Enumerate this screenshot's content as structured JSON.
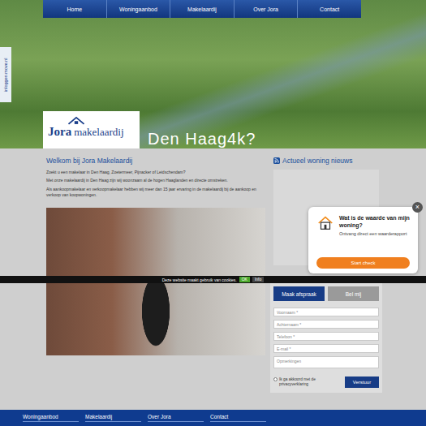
{
  "nav": [
    "Home",
    "Woningaanbod",
    "Makelaardij",
    "Over Jora",
    "Contact"
  ],
  "side_tab": "inloggen move.nl",
  "logo": {
    "name": "Jora",
    "suffix": "makelaardij"
  },
  "hero_caption": "Den Haag4k?",
  "welcome": {
    "title": "Welkom bij Jora Makelaardij",
    "paragraphs": [
      "Zoekt u een makelaar in Den Haag, Zoetermeer, Pijnacker of Leidschendam?",
      "Met onze makelaardij in Den Haag zijn wij woonzaam al de hogen Haaglanden en directe omstreken.",
      "Als aankoopmakelaar en verkoopmakelaar hebben wij meer dan 15 jaar ervaring in de makelaardij bij de aankoop en verkoop van koopwoningen."
    ]
  },
  "news": {
    "title": "Actueel woning nieuws"
  },
  "popup": {
    "close": "×",
    "title": "Wat is de waarde van mijn woning?",
    "text": "Ontvang direct een waarderapport",
    "button": "Start check"
  },
  "cookie": {
    "text": "Deze website maakt gebruik van cookies.",
    "ok": "OK",
    "info": "Info"
  },
  "contact": {
    "tabs": [
      {
        "label": "Maak afspraak",
        "selected": true
      },
      {
        "label": "Bel mij",
        "selected": false
      }
    ],
    "fields": [
      {
        "placeholder": "Voornaam *",
        "kind": "input"
      },
      {
        "placeholder": "Achternaam *",
        "kind": "input"
      },
      {
        "placeholder": "Telefoon *",
        "kind": "input"
      },
      {
        "placeholder": "E-mail *",
        "kind": "input"
      },
      {
        "placeholder": "Opmerkingen",
        "kind": "textarea"
      }
    ],
    "consent": {
      "label": "Ik ga akkoord met de privacyverklaring",
      "checked": false
    },
    "submit": "Verstuur"
  },
  "footer": [
    "Woningaanbod",
    "Makelaardij",
    "Over Jora",
    "Contact"
  ]
}
